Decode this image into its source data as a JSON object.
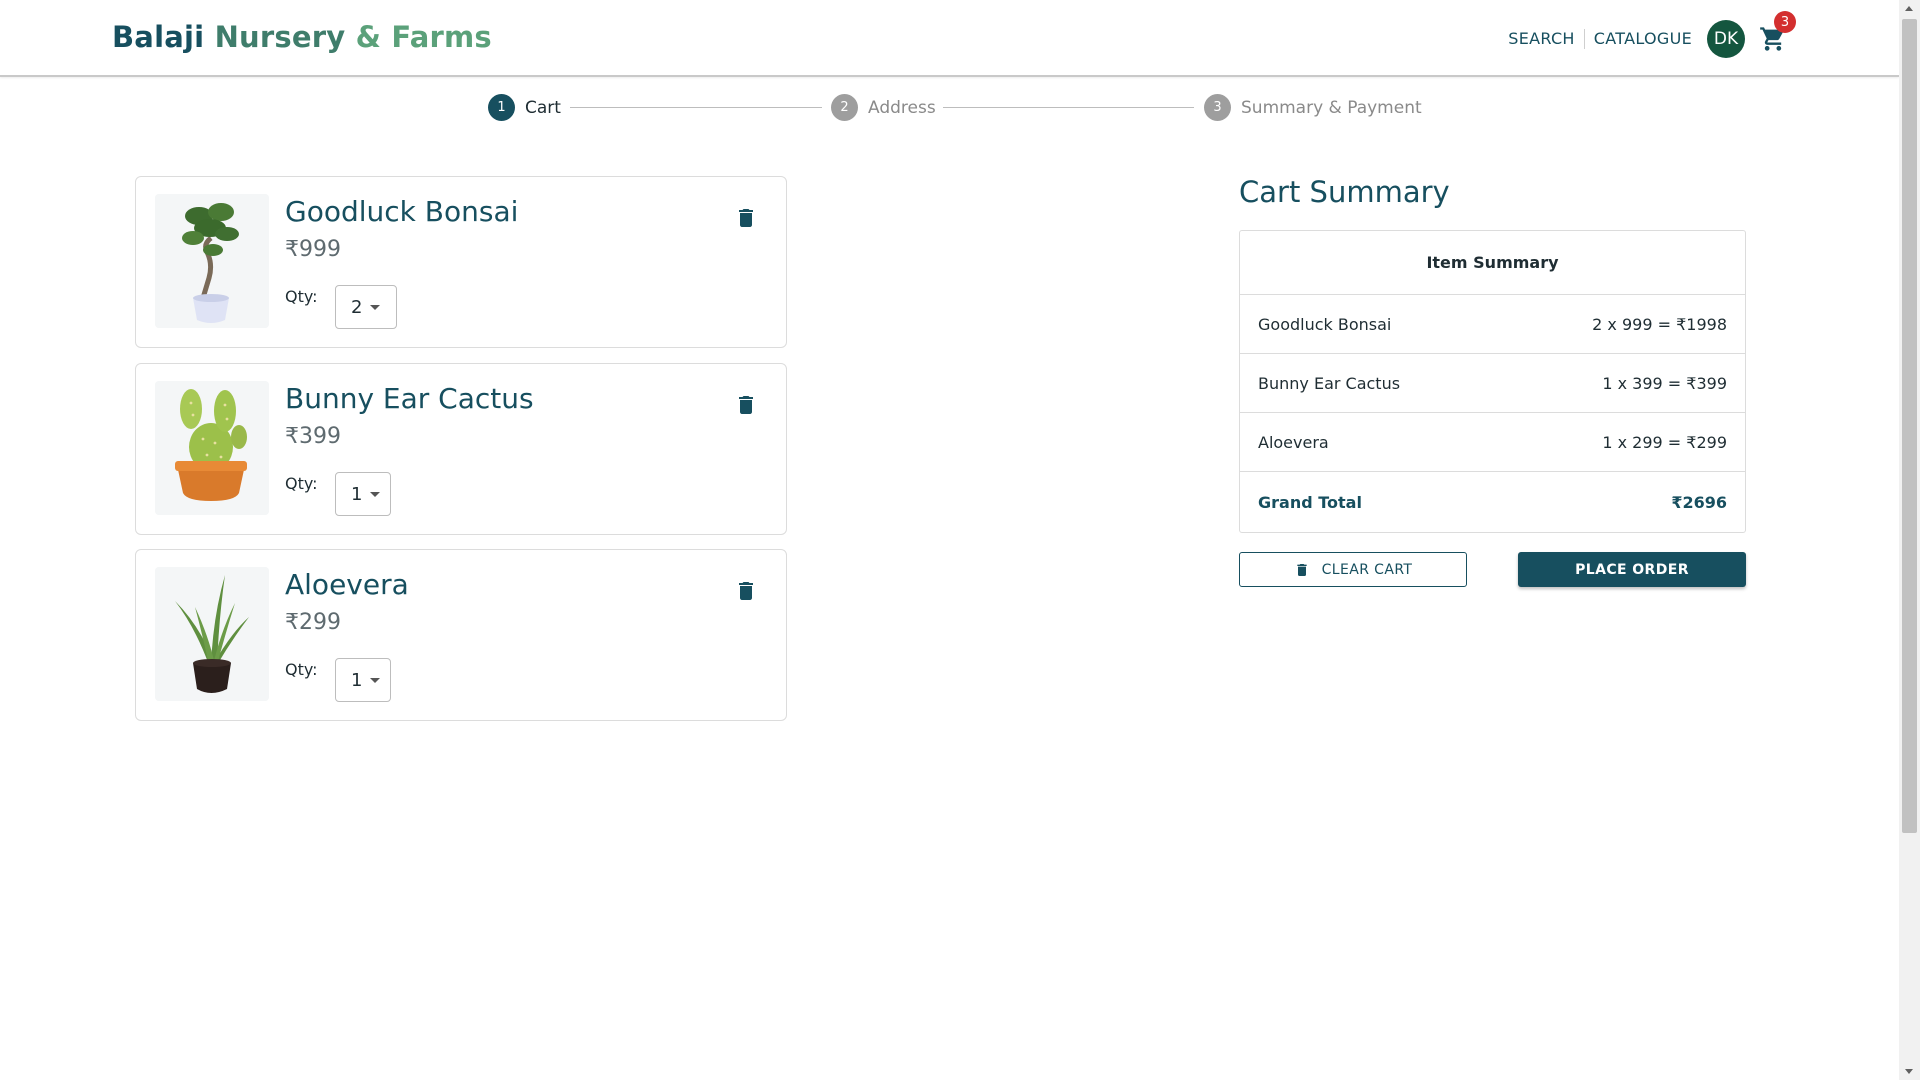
{
  "brand": {
    "part1": "Balaji",
    "part2": "Nursery",
    "part3": "& Farms"
  },
  "nav": {
    "search": "SEARCH",
    "catalogue": "CATALOGUE",
    "avatar_initials": "DK",
    "cart_count": "3"
  },
  "stepper": [
    {
      "number": "1",
      "label": "Cart",
      "state": "active"
    },
    {
      "number": "2",
      "label": "Address",
      "state": "inactive"
    },
    {
      "number": "3",
      "label": "Summary & Payment",
      "state": "inactive"
    }
  ],
  "cart_items": [
    {
      "name": "Goodluck Bonsai",
      "price": "₹999",
      "qty_label": "Qty:",
      "qty": "2",
      "image": "bonsai-plant"
    },
    {
      "name": "Bunny Ear Cactus",
      "price": "₹399",
      "qty_label": "Qty:",
      "qty": "1",
      "image": "cactus-plant"
    },
    {
      "name": "Aloevera",
      "price": "₹299",
      "qty_label": "Qty:",
      "qty": "1",
      "image": "aloevera-plant"
    }
  ],
  "summary": {
    "title": "Cart Summary",
    "header": "Item Summary",
    "rows": [
      {
        "name": "Goodluck Bonsai",
        "calc": "2 x 999 = ₹1998"
      },
      {
        "name": "Bunny Ear Cactus",
        "calc": "1 x 399 = ₹399"
      },
      {
        "name": "Aloevera",
        "calc": "1 x 299 = ₹299"
      }
    ],
    "grand_total_label": "Grand Total",
    "grand_total_value": "₹2696",
    "clear_cart": "CLEAR CART",
    "place_order": "PLACE ORDER"
  },
  "colors": {
    "primary": "#174f5f",
    "avatar": "#14563f",
    "badge": "#d32f2f",
    "brand_green": "#5ba17a"
  }
}
